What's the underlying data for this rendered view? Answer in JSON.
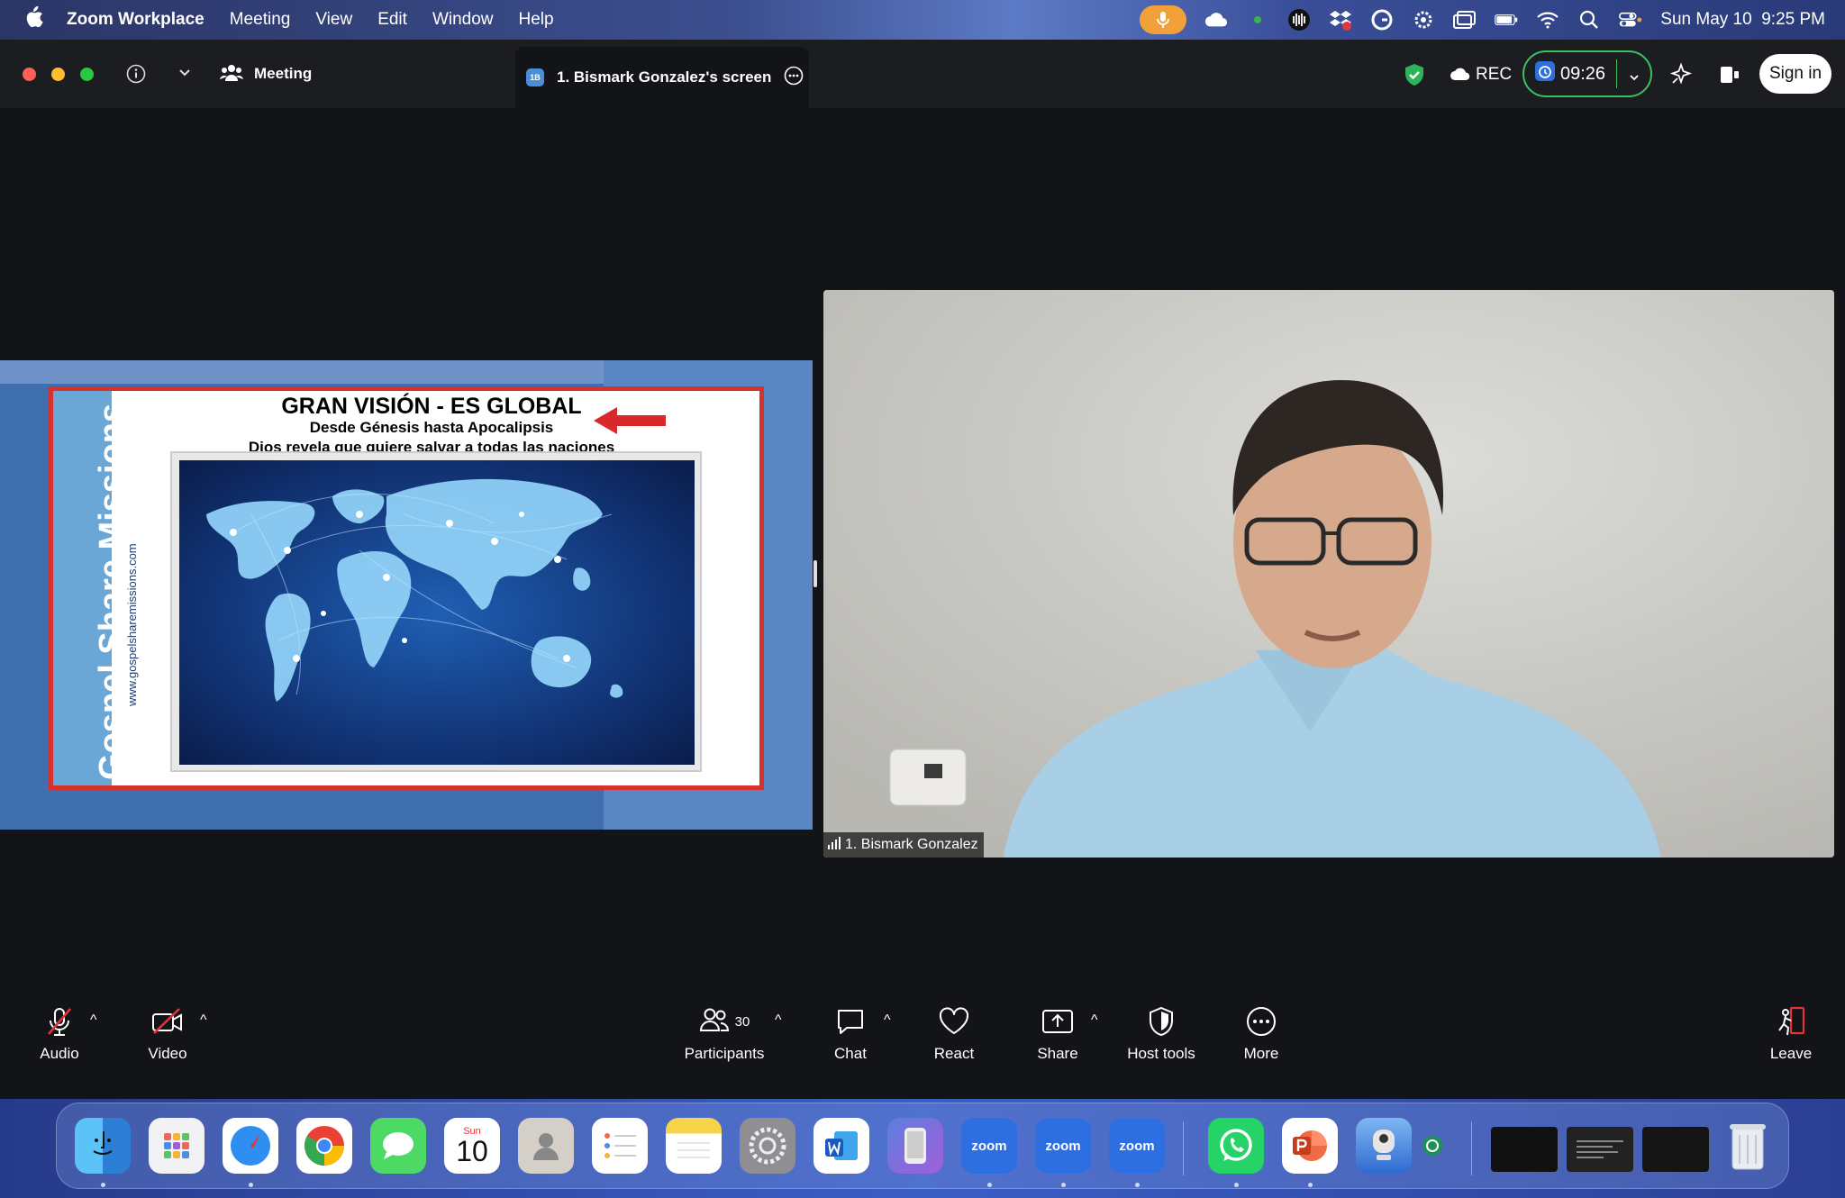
{
  "menubar": {
    "app_name": "Zoom Workplace",
    "items": [
      "Meeting",
      "View",
      "Edit",
      "Window",
      "Help"
    ],
    "clock": "Sun May 10  9:25 PM"
  },
  "titlebar": {
    "meeting_label": "Meeting",
    "tab_badge": "1B",
    "tab_title": "1. Bismark Gonzalez's screen",
    "rec_label": "REC",
    "timer": "09:26",
    "sign_in": "Sign in"
  },
  "slide": {
    "title": "GRAN VISIÓN - ES GLOBAL",
    "subtitle1": "Desde Génesis hasta Apocalipsis",
    "subtitle2": "Dios revela que quiere salvar a todas las naciones",
    "side_title": "Gospel Share Missions",
    "side_url": "www.gospelsharemissions.com"
  },
  "video": {
    "participant_name": "1. Bismark Gonzalez"
  },
  "toolbar": {
    "audio": "Audio",
    "video": "Video",
    "participants": "Participants",
    "participants_count": "30",
    "chat": "Chat",
    "react": "React",
    "share": "Share",
    "host_tools": "Host tools",
    "more": "More",
    "leave": "Leave"
  },
  "dock": {
    "calendar_month": "Sun",
    "calendar_day": "10",
    "zoom_label": "zoom"
  },
  "colors": {
    "record_green": "#3cc060",
    "slide_border": "#d5322d",
    "mic_pill": "#f2a03a"
  }
}
